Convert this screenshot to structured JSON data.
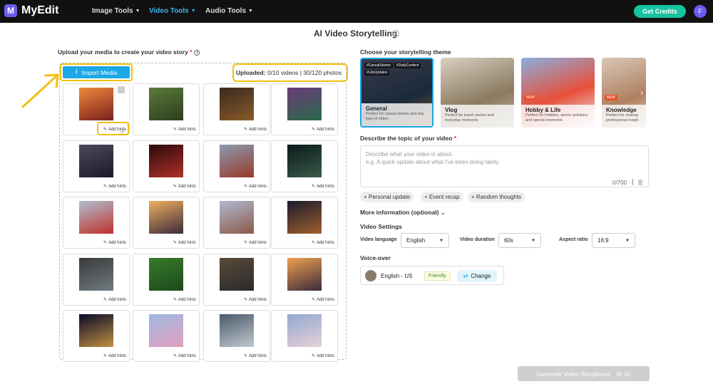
{
  "app": {
    "name": "MyEdit",
    "logo_letter": "M"
  },
  "nav": [
    {
      "label": "Image Tools",
      "active": false
    },
    {
      "label": "Video Tools",
      "active": true
    },
    {
      "label": "Audio Tools",
      "active": false
    }
  ],
  "header": {
    "credits_label": "Get Credits",
    "avatar_initial": "F"
  },
  "page": {
    "title": "AI Video Storytelling"
  },
  "upload": {
    "label": "Upload your media to create your video story",
    "required_mark": "*",
    "import_label": "Import Media",
    "status_prefix": "Uploaded:",
    "status_value": "0/10 videos | 30/120 photos",
    "hint_label": "Add hints"
  },
  "media": [
    {
      "scene": "torii sunset"
    },
    {
      "scene": "deer park"
    },
    {
      "scene": "restaurant"
    },
    {
      "scene": "kimono street"
    },
    {
      "scene": "shibuya crossing"
    },
    {
      "scene": "lantern alley"
    },
    {
      "scene": "temple pagoda"
    },
    {
      "scene": "night street"
    },
    {
      "scene": "red gate"
    },
    {
      "scene": "tokyo tower sunset"
    },
    {
      "scene": "kyoto temple"
    },
    {
      "scene": "lit alley"
    },
    {
      "scene": "subway station"
    },
    {
      "scene": "bamboo forest"
    },
    {
      "scene": "museum hall"
    },
    {
      "scene": "fuji pagoda"
    },
    {
      "scene": "night tower"
    },
    {
      "scene": "fuji cherry"
    },
    {
      "scene": "city view window"
    },
    {
      "scene": "castle blossom"
    }
  ],
  "themes": {
    "label": "Choose your storytelling theme",
    "items": [
      {
        "name": "General",
        "desc": "Perfect for casual stories and any type of video",
        "tags": [
          "#CasualStories",
          "#DailyContent",
          "#LifeUpdates"
        ],
        "badge": "",
        "selected": true
      },
      {
        "name": "Vlog",
        "desc": "Perfect for travel stories and everyday moments",
        "tags": [],
        "badge": "",
        "selected": false
      },
      {
        "name": "Hobby & Life",
        "desc": "Perfect for hobbies, sports activities, and special moments",
        "tags": [],
        "badge": "NEW",
        "selected": false
      },
      {
        "name": "Knowledge",
        "desc": "Perfect for sharing professional insigh",
        "tags": [],
        "badge": "NEW",
        "selected": false
      }
    ]
  },
  "topic": {
    "label": "Describe the topic of your video",
    "required_mark": "*",
    "placeholder_line1": "Describe what your video is about.",
    "placeholder_line2": "e.g. A quick update about what I've been doing lately.",
    "counter": "0/700"
  },
  "chips": [
    "+ Personal update",
    "+ Event recap",
    "+ Random thoughts"
  ],
  "more_info": {
    "label": "More information (optional)"
  },
  "settings": {
    "label": "Video Settings",
    "language_label": "Video language",
    "language_value": "English",
    "duration_label": "Video duration",
    "duration_value": "60s",
    "aspect_label": "Aspect ratio",
    "aspect_value": "16:9"
  },
  "voiceover": {
    "label": "Voice-over",
    "voice_name": "English - US",
    "voice_style": "Friendly",
    "change_label": "Change"
  },
  "generate": {
    "label": "Generate Video Storyboard",
    "cost": "20"
  },
  "colors": {
    "accent": "#1ba8e6",
    "highlight": "#f2c010",
    "credits": "#16c3a0",
    "brand": "#6b5cf0"
  }
}
